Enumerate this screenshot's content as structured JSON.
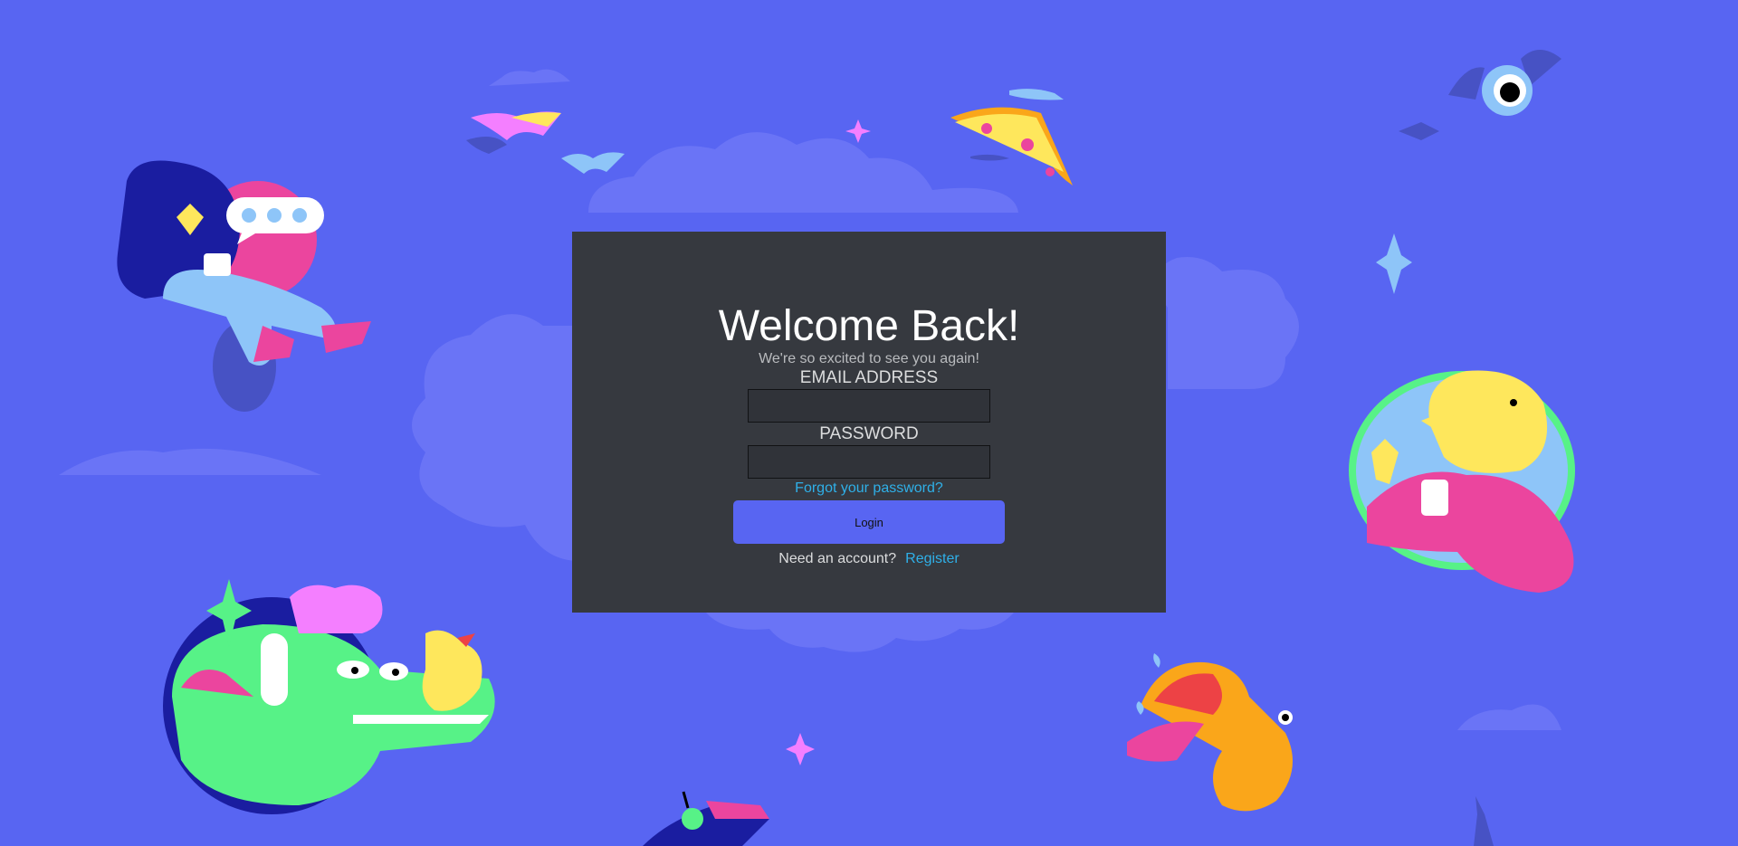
{
  "login": {
    "title": "Welcome Back!",
    "subtitle": "We're so excited to see you again!",
    "email_label": "EMAIL ADDRESS",
    "email_value": "",
    "password_label": "PASSWORD",
    "password_value": "",
    "forgot_link": "Forgot your password?",
    "login_button": "Login",
    "need_account": "Need an account?",
    "register_link": "Register"
  },
  "colors": {
    "background": "#5865F2",
    "card": "#36393F",
    "link": "#2FB0E8",
    "button": "#5865F2"
  },
  "illustrations": [
    "girl-on-phone-illustration",
    "books-bird-illustration",
    "pizza-slice-illustration",
    "bat-eye-illustration",
    "yellow-character-badge-illustration",
    "green-dinosaur-duck-illustration",
    "trumpet-tongue-illustration",
    "toy-vehicle-illustration",
    "sparkle-icon",
    "cloud-shape"
  ]
}
